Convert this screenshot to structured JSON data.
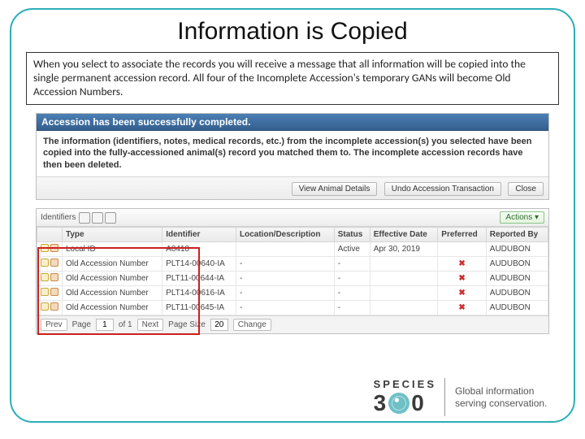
{
  "title": "Information is Copied",
  "intro": "When you select to associate the records you will receive a message that all information will be copied into the single permanent accession record. All four of the Incomplete Accession's temporary GANs will become Old Accession Numbers.",
  "dialog": {
    "banner": "Accession has been successfully completed.",
    "message": "The information (identifiers, notes, medical records, etc.) from the incomplete accession(s) you selected have been copied into the fully-accessioned animal(s) record you matched them to. The incomplete accession records have then been deleted.",
    "buttons": {
      "view": "View Animal Details",
      "undo": "Undo Accession Transaction",
      "close": "Close"
    }
  },
  "panel": {
    "title": "Identifiers",
    "actions_label": "Actions ▾",
    "headers": [
      "",
      "Type",
      "Identifier",
      "Location/Description",
      "Status",
      "Effective Date",
      "Preferred",
      "Reported By"
    ],
    "rows": [
      {
        "type": "Local ID",
        "identifier": "A0418",
        "location": "",
        "status": "Active",
        "date": "Apr 30, 2019",
        "preferred": "",
        "reported": "AUDUBON"
      },
      {
        "type": "Old Accession Number",
        "identifier": "PLT14-00640-IA",
        "location": "-",
        "status": "-",
        "date": "",
        "preferred": "✖",
        "reported": "AUDUBON"
      },
      {
        "type": "Old Accession Number",
        "identifier": "PLT11-00644-IA",
        "location": "-",
        "status": "-",
        "date": "",
        "preferred": "✖",
        "reported": "AUDUBON"
      },
      {
        "type": "Old Accession Number",
        "identifier": "PLT14-00616-IA",
        "location": "-",
        "status": "-",
        "date": "",
        "preferred": "✖",
        "reported": "AUDUBON"
      },
      {
        "type": "Old Accession Number",
        "identifier": "PLT11-00645-IA",
        "location": "-",
        "status": "-",
        "date": "",
        "preferred": "✖",
        "reported": "AUDUBON"
      }
    ],
    "pager": {
      "prev": "Prev",
      "page_label": "Page",
      "page": "1",
      "of_label": "of 1",
      "next": "Next",
      "size_label": "Page Size",
      "size": "20",
      "change": "Change"
    }
  },
  "footer": {
    "brand_word": "SPECIES",
    "brand_num_left": "3",
    "brand_num_right": "0",
    "tagline": "Global information serving conservation."
  }
}
